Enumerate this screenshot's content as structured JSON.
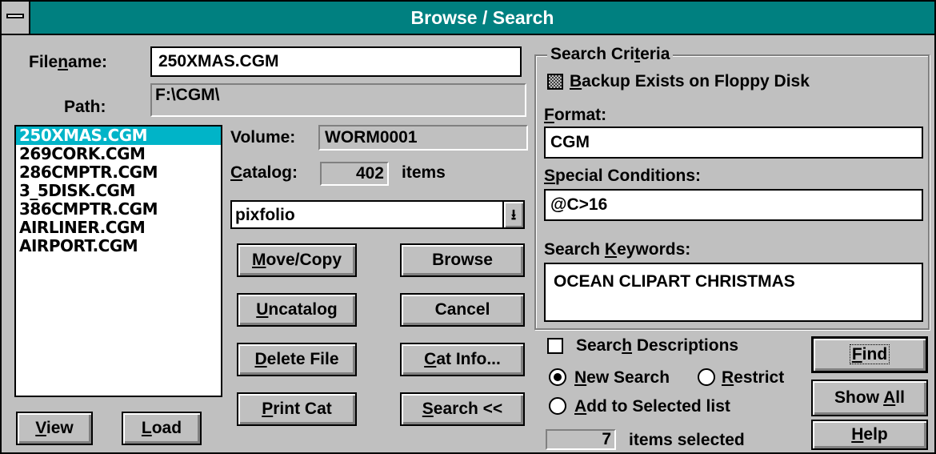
{
  "window": {
    "title": "Browse / Search"
  },
  "filename": {
    "label_pre": "File",
    "label_u": "n",
    "label_post": "ame:",
    "value": "250XMAS.CGM"
  },
  "path": {
    "label": "Path:",
    "value": "F:\\CGM\\"
  },
  "file_list": [
    "250XMAS.CGM",
    "269CORK.CGM",
    "286CMPTR.CGM",
    "3_5DISK.CGM",
    "386CMPTR.CGM",
    "AIRLINER.CGM",
    "AIRPORT.CGM"
  ],
  "volume": {
    "label": "Volume:",
    "value": "WORM0001"
  },
  "catalog": {
    "label_u": "C",
    "label_post": "atalog:",
    "count": "402",
    "unit": "items"
  },
  "catalog_select": {
    "value": "pixfolio",
    "arrow": "down-arrow-icon"
  },
  "buttons": {
    "move_copy": {
      "u": "M",
      "post": "ove/Copy"
    },
    "browse": {
      "label": "Browse"
    },
    "uncatalog": {
      "u": "U",
      "post": "ncatalog"
    },
    "cancel": {
      "label": "Cancel"
    },
    "delete_file": {
      "u": "D",
      "post": "elete File"
    },
    "cat_info": {
      "u": "C",
      "post": "at Info..."
    },
    "print_cat": {
      "u": "P",
      "post": "rint Cat"
    },
    "search": {
      "u": "S",
      "post": "earch <<"
    },
    "view": {
      "u": "V",
      "post": "iew"
    },
    "load": {
      "u": "L",
      "post": "oad"
    },
    "find": {
      "u": "F",
      "post": "ind"
    },
    "show_all": {
      "pre": "Show ",
      "u": "A",
      "post": "ll"
    },
    "help": {
      "u": "H",
      "post": "elp"
    }
  },
  "criteria": {
    "group_title_pre": "Search Cri",
    "group_title_u": "t",
    "group_title_post": "eria",
    "backup": {
      "u": "B",
      "post": "ackup Exists on Floppy Disk"
    },
    "format": {
      "u": "F",
      "post": "ormat:",
      "value": "CGM"
    },
    "special": {
      "u": "S",
      "post": "pecial Conditions:",
      "value": "@C>16"
    },
    "keywords": {
      "pre": "Search ",
      "u": "K",
      "post": "eywords:",
      "value": "OCEAN CLIPART CHRISTMAS"
    }
  },
  "options": {
    "search_desc": {
      "pre": "Searc",
      "u": "h",
      "post": " Descriptions"
    },
    "new_search": {
      "u": "N",
      "post": "ew Search"
    },
    "restrict": {
      "u": "R",
      "post": "estrict"
    },
    "add_selected": {
      "u": "A",
      "post": "dd to Selected list"
    }
  },
  "selected": {
    "count": "7",
    "label": "items selected"
  }
}
